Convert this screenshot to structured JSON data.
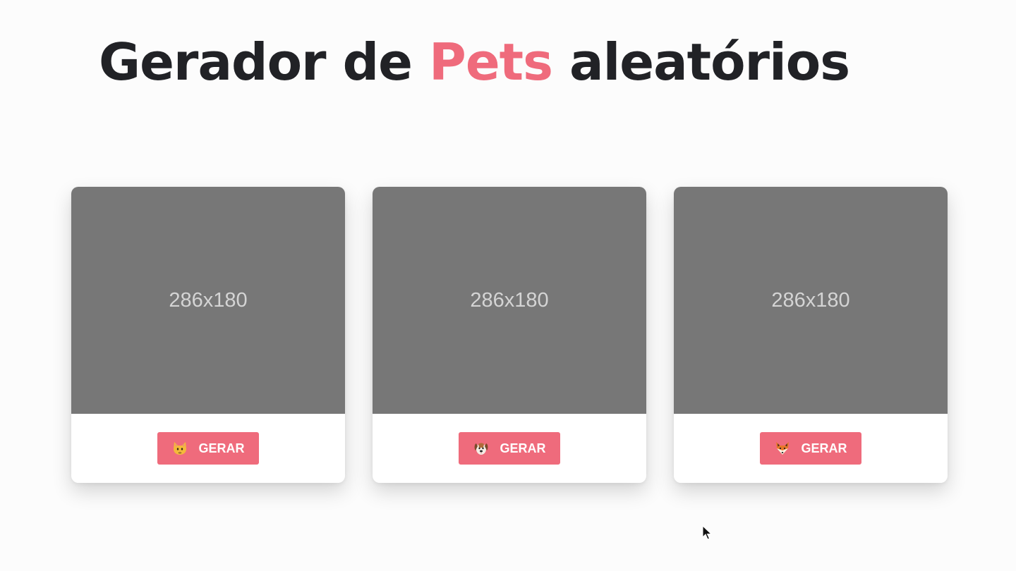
{
  "header": {
    "title_part1": "Gerador de ",
    "title_accent": "Pets",
    "title_part2": " aleatórios"
  },
  "colors": {
    "accent": "#ef6b7c",
    "title_text": "#212226",
    "placeholder_bg": "#777777",
    "placeholder_text": "#d4d4d4",
    "background": "#fcfcfc"
  },
  "cards": [
    {
      "placeholder_text": "286x180",
      "button_label": "GERAR",
      "icon": "cat-face-icon"
    },
    {
      "placeholder_text": "286x180",
      "button_label": "GERAR",
      "icon": "dog-face-icon"
    },
    {
      "placeholder_text": "286x180",
      "button_label": "GERAR",
      "icon": "fox-face-icon"
    }
  ]
}
